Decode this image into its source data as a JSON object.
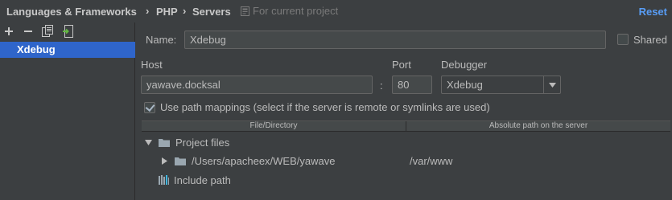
{
  "breadcrumb": {
    "items": [
      "Languages & Frameworks",
      "PHP",
      "Servers"
    ],
    "separator": "›",
    "scope_label": "For current project",
    "reset_label": "Reset"
  },
  "toolbar": {
    "icons": [
      "add-icon",
      "remove-icon",
      "copy-icon",
      "import-icon"
    ]
  },
  "servers": {
    "items": [
      {
        "label": "Xdebug",
        "selected": true
      }
    ]
  },
  "form": {
    "name_label": "Name:",
    "name_value": "Xdebug",
    "shared_label": "Shared",
    "shared_checked": false,
    "host_label": "Host",
    "host_value": "yawave.docksal",
    "colon": ":",
    "port_label": "Port",
    "port_value": "80",
    "debugger_label": "Debugger",
    "debugger_value": "Xdebug",
    "path_mappings_label": "Use path mappings (select if the server is remote or symlinks are used)",
    "path_mappings_checked": true
  },
  "mappings": {
    "columns": [
      "File/Directory",
      "Absolute path on the server"
    ],
    "project_files_label": "Project files",
    "rows": [
      {
        "local": "/Users/apacheex/WEB/yawave",
        "remote": "/var/www"
      }
    ],
    "include_path_label": "Include path"
  },
  "colors": {
    "background": "#3c3f41",
    "selection": "#2f65ca",
    "link": "#589df6",
    "add_icon": "#c8c8c8",
    "import_icon": "#62b543"
  }
}
